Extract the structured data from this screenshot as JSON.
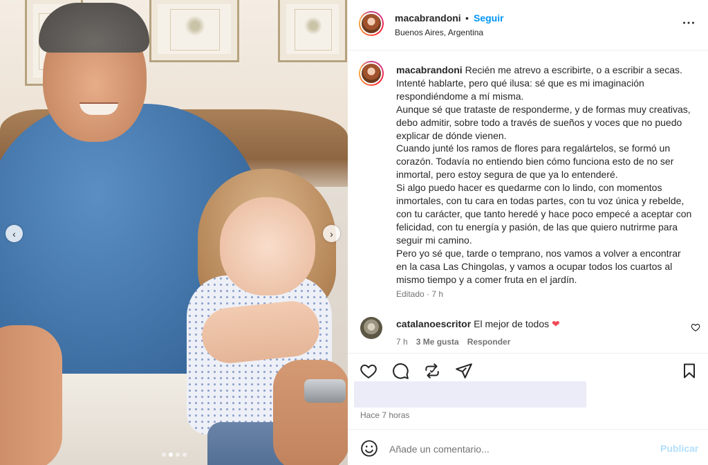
{
  "post": {
    "username": "macabrandoni",
    "separator": "•",
    "follow_label": "Seguir",
    "location": "Buenos Aires, Argentina",
    "more_icon": "more-options-icon"
  },
  "caption": {
    "username": "macabrandoni",
    "paragraphs": [
      "Recién me atrevo a escribirte, o a escribir a secas. Intenté hablarte, pero qué ilusa: sé que es mi imaginación respondiéndome a mí misma.",
      "Aunque sé que trataste de responderme, y de formas muy creativas, debo admitir, sobre todo a través de sueños y voces que no puedo explicar de dónde vienen.",
      "Cuando junté los ramos de flores para regalártelos, se formó un corazón. Todavía no entiendo bien cómo funciona esto de no ser inmortal, pero estoy segura de que ya lo entenderé.",
      "Si algo puedo hacer es quedarme con lo lindo, con momentos inmortales, con tu cara en todas partes, con tu voz única y rebelde, con tu carácter, que tanto heredé y hace poco empecé a aceptar con felicidad, con tu energía y pasión, de las que quiero nutrirme para seguir mi camino.",
      "Pero yo sé que, tarde o temprano, nos vamos a volver a encontrar en la casa Las Chingolas, y vamos a ocupar todos los cuartos al mismo tiempo y a comer fruta en el jardín."
    ],
    "meta": "Editado · 7 h"
  },
  "comment": {
    "username": "catalanoescritor",
    "text": "El mejor de todos",
    "emoji": "❤",
    "time": "7 h",
    "likes": "3 Me gusta",
    "reply_label": "Responder"
  },
  "footer": {
    "time_ago": "Hace 7 horas",
    "comment_placeholder": "Añade un comentario...",
    "publish_label": "Publicar"
  },
  "carousel": {
    "prev_glyph": "‹",
    "next_glyph": "›"
  },
  "colors": {
    "accent_blue": "#0095f6",
    "publish_disabled": "#b2dffc",
    "heart_red": "#ed4956",
    "muted_text": "#737373"
  }
}
